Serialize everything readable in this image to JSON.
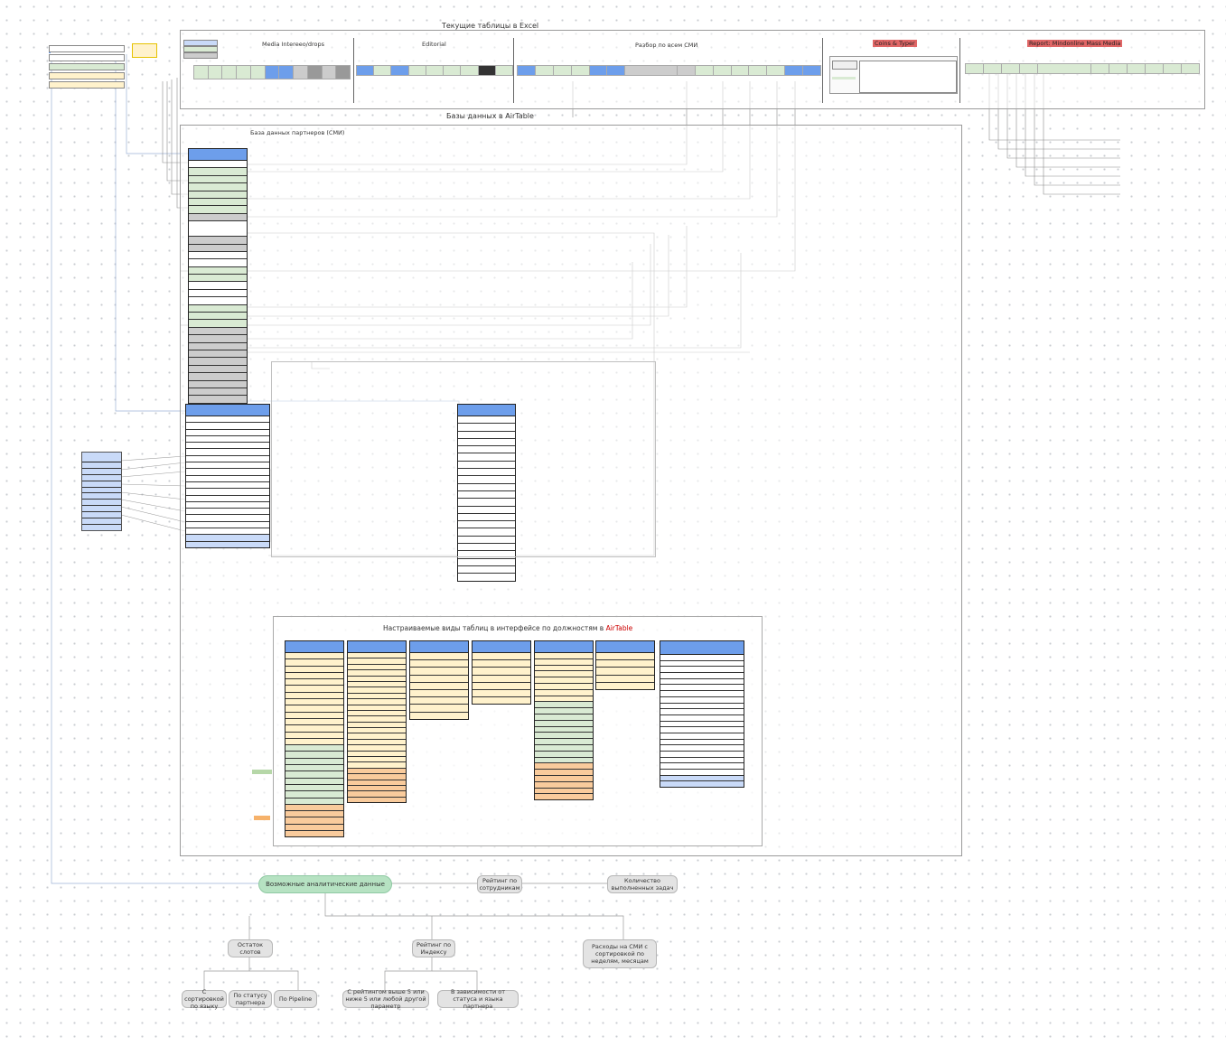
{
  "excel": {
    "title": "Текущие таблицы в Excel",
    "sheets": [
      {
        "title": "Media Intereeo/drops"
      },
      {
        "title": "Editorial"
      },
      {
        "title": "Разбор по всем СМИ"
      },
      {
        "title": "Coins & Typer"
      },
      {
        "title": "Report: Mindonline Mass Media"
      }
    ]
  },
  "airtable": {
    "title": "Базы данных в AirTable",
    "partners_db_title": "База данных партнеров (СМИ)"
  },
  "views": {
    "title_prefix": "Настраиваемые виды таблиц в интерфейсе по должностям в ",
    "title_brand": "AirTable"
  },
  "analytics": {
    "main": "Возможные аналитические данные",
    "rating_staff": "Рейтинг по сотрудникам",
    "tasks_done": "Количество выполненных задач",
    "slots_left": "Остаток слотов",
    "rating_index": "Рейтинг по Индексу",
    "smi_costs": "Расходы на СМИ с сортировкой по неделям, месяцам",
    "sort_language": "С сортировкой по языку",
    "by_partner_status": "По статусу партнера",
    "by_pipeline": "По Pipeline",
    "rating_above": "С рейтингом выше 5 или ниже 5 или любой другой параметр",
    "by_status_language": "В зависимости от статуса и языка партнера"
  }
}
